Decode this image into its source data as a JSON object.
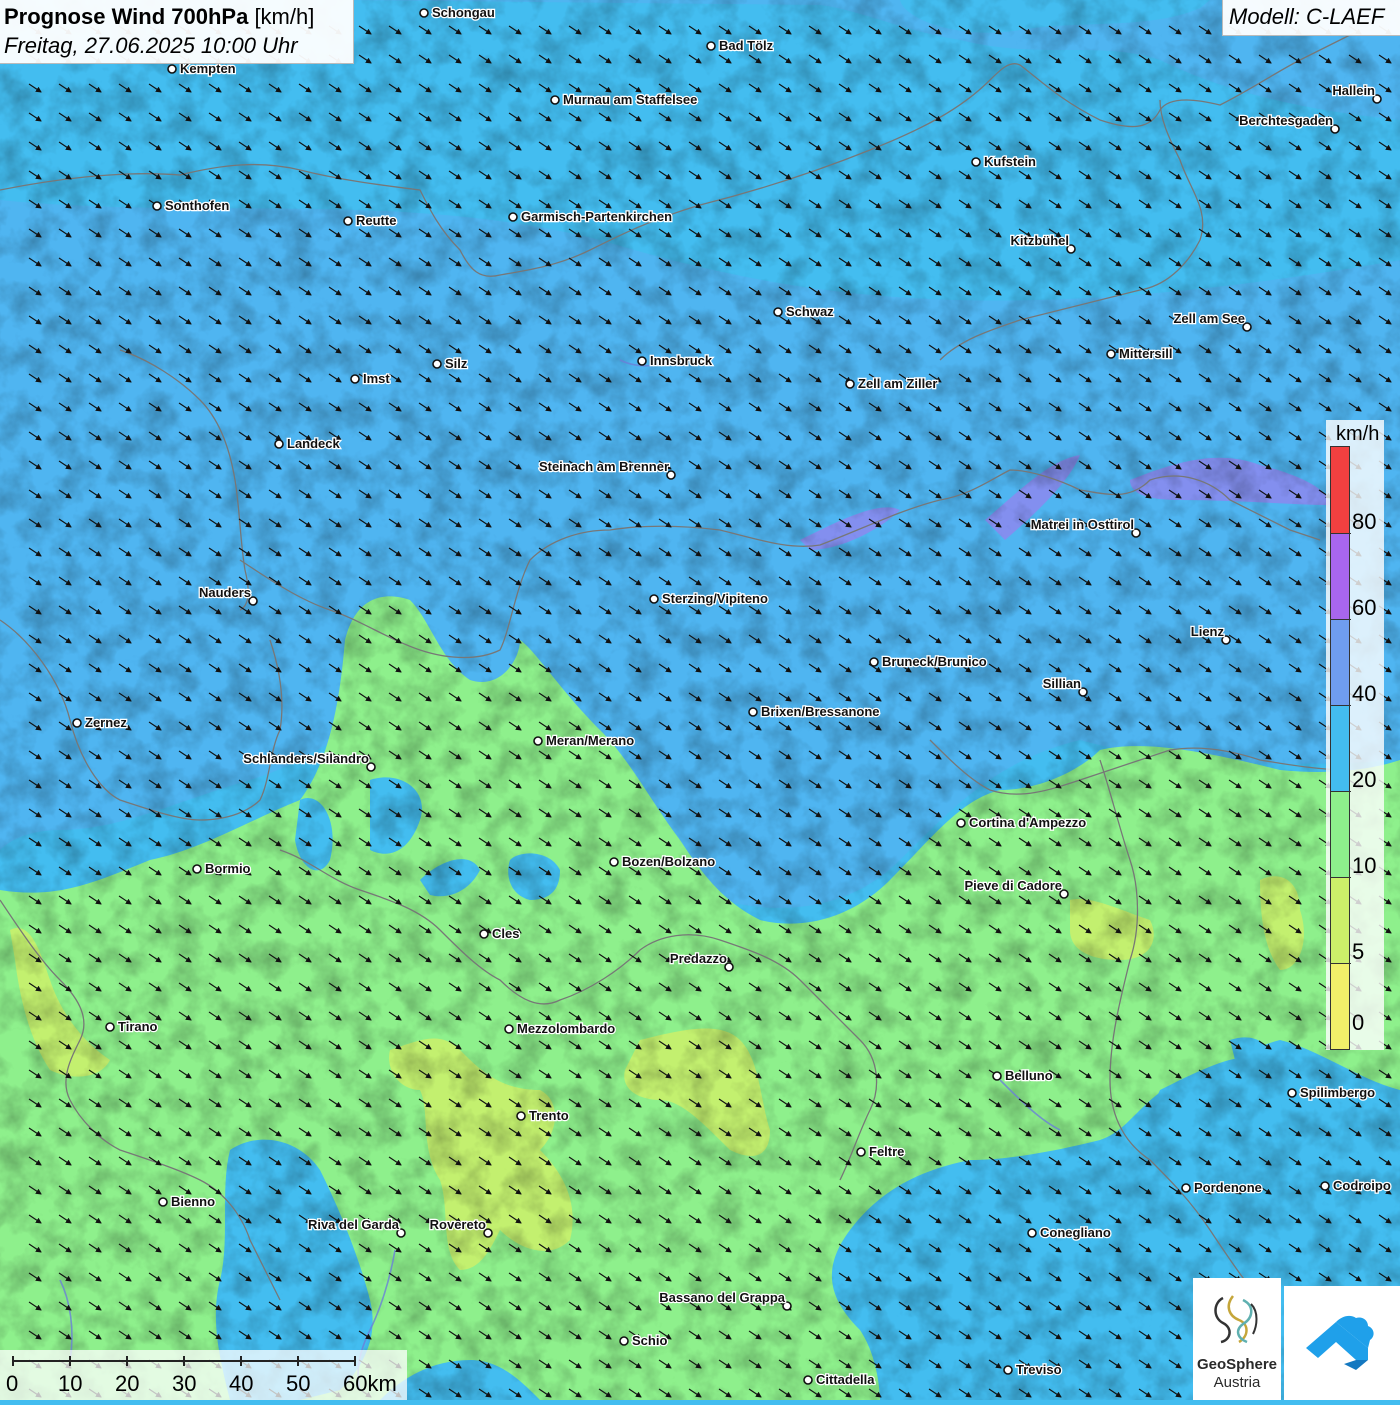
{
  "title": {
    "bold": "Prognose Wind 700hPa",
    "unit": "[km/h]",
    "date": "Freitag, 27.06.2025 10:00 Uhr"
  },
  "model": "Modell: C-LAEF",
  "legend": {
    "unit": "km/h",
    "labels": [
      "80",
      "60",
      "40",
      "20",
      "10",
      "5",
      "0"
    ],
    "classes": [
      {
        "from": 80,
        "color": "#f24040"
      },
      {
        "from": 60,
        "color": "#a866ee"
      },
      {
        "from": 40,
        "color": "#6f9df0"
      },
      {
        "from": 20,
        "color": "#43bdf0"
      },
      {
        "from": 10,
        "color": "#8ef08c"
      },
      {
        "from": 5,
        "color": "#cdf06a"
      },
      {
        "from": 0,
        "color": "#f2f06a"
      }
    ]
  },
  "scale": {
    "labels": [
      "0",
      "10",
      "20",
      "30",
      "40",
      "50",
      "60km"
    ]
  },
  "cities": [
    {
      "name": "Schongau",
      "side": "right"
    },
    {
      "name": "Bad Tölz",
      "side": "right"
    },
    {
      "name": "Kempten",
      "side": "right"
    },
    {
      "name": "Murnau am Staffelsee",
      "side": "right"
    },
    {
      "name": "Hallein",
      "side": "left"
    },
    {
      "name": "Berchtesgaden",
      "side": "left"
    },
    {
      "name": "Kufstein",
      "side": "right"
    },
    {
      "name": "Sonthofen",
      "side": "right"
    },
    {
      "name": "Reutte",
      "side": "right"
    },
    {
      "name": "Garmisch-Partenkirchen",
      "side": "right"
    },
    {
      "name": "Kitzbühel",
      "side": "left"
    },
    {
      "name": "Schwaz",
      "side": "right"
    },
    {
      "name": "Zell am See",
      "side": "left"
    },
    {
      "name": "Mittersill",
      "side": "right"
    },
    {
      "name": "Innsbruck",
      "side": "right"
    },
    {
      "name": "Silz",
      "side": "right"
    },
    {
      "name": "Imst",
      "side": "right"
    },
    {
      "name": "Zell am Ziller",
      "side": "right"
    },
    {
      "name": "Landeck",
      "side": "right"
    },
    {
      "name": "Steinach am Brenner",
      "side": "left"
    },
    {
      "name": "Matrei in Osttirol",
      "side": "left"
    },
    {
      "name": "Nauders",
      "side": "left"
    },
    {
      "name": "Sterzing/Vipiteno",
      "side": "right"
    },
    {
      "name": "Lienz",
      "side": "left"
    },
    {
      "name": "Bruneck/Brunico",
      "side": "right"
    },
    {
      "name": "Sillian",
      "side": "left"
    },
    {
      "name": "Zernez",
      "side": "right"
    },
    {
      "name": "Brixen/Bressanone",
      "side": "right"
    },
    {
      "name": "Meran/Merano",
      "side": "right"
    },
    {
      "name": "Schlanders/Silandro",
      "side": "left"
    },
    {
      "name": "Cortina d'Ampezzo",
      "side": "right"
    },
    {
      "name": "Bozen/Bolzano",
      "side": "right"
    },
    {
      "name": "Bormio",
      "side": "right"
    },
    {
      "name": "Pieve di Cadore",
      "side": "left"
    },
    {
      "name": "Cles",
      "side": "right"
    },
    {
      "name": "Predazzo",
      "side": "left"
    },
    {
      "name": "Tirano",
      "side": "right"
    },
    {
      "name": "Mezzolombardo",
      "side": "right"
    },
    {
      "name": "Belluno",
      "side": "right"
    },
    {
      "name": "Spilimbergo",
      "side": "right"
    },
    {
      "name": "Trento",
      "side": "right"
    },
    {
      "name": "Feltre",
      "side": "right"
    },
    {
      "name": "Pordenone",
      "side": "right"
    },
    {
      "name": "Codroipo",
      "side": "right"
    },
    {
      "name": "Bienno",
      "side": "right"
    },
    {
      "name": "Riva del Garda",
      "side": "left"
    },
    {
      "name": "Rovereto",
      "side": "left"
    },
    {
      "name": "Conegliano",
      "side": "right"
    },
    {
      "name": "Bassano del Grappa",
      "side": "left"
    },
    {
      "name": "Schio",
      "side": "right"
    },
    {
      "name": "Treviso",
      "side": "right"
    },
    {
      "name": "Cittadella",
      "side": "right"
    }
  ],
  "logos": {
    "geosphere_line1": "GeoSphere",
    "geosphere_line2": "Austria"
  }
}
